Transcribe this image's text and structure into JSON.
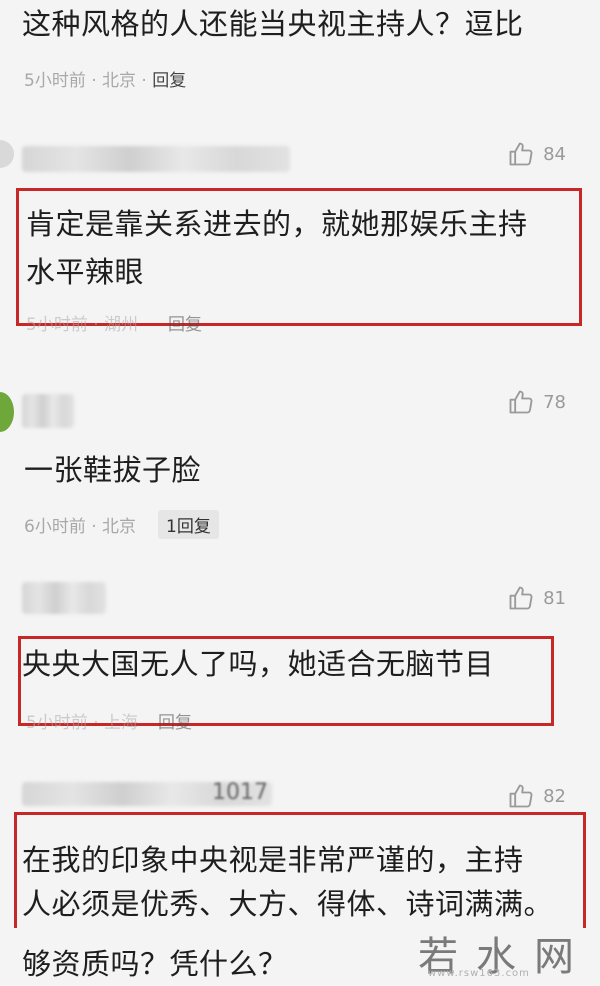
{
  "comments": [
    {
      "text": "这种风格的人还能当央视主持人？逗比",
      "meta_time": "5小时前 · 北京",
      "meta_sep": " · ",
      "reply": "回复"
    },
    {
      "likes": "84",
      "text_line1": "肯定是靠关系进去的，就她那娱乐主持",
      "text_line2": "水平辣眼",
      "meta_time": "5小时前 · 湖州",
      "reply": "回复"
    },
    {
      "likes": "78",
      "text": "一张鞋拔子脸",
      "meta_time": "6小时前 · 北京",
      "reply": "1回复"
    },
    {
      "likes": "81",
      "text": "央央大国无人了吗，她适合无脑节目",
      "meta_time": "5小时前 · 上海",
      "reply": "回复"
    },
    {
      "likes": "82",
      "name_partial": "1017",
      "text_line1": "在我的印象中央视是非常严谨的，主持",
      "text_line2": "人必须是优秀、大方、得体、诗词满满。",
      "text_line3": "够资质吗？凭什么？"
    }
  ],
  "watermark": {
    "text": "若水网",
    "sub": "www.rsw163.com"
  },
  "colors": {
    "highlight_border": "#c62828",
    "background": "#f4f4f4"
  },
  "icons": {
    "like": "thumbs-up-icon"
  }
}
